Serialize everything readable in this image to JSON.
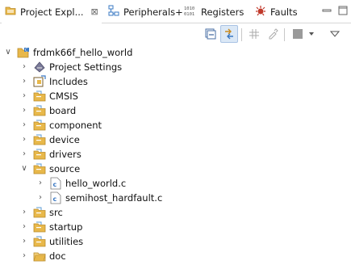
{
  "tabs": [
    {
      "label": "Project Expl...",
      "icon": "project-explorer-icon",
      "active": true
    },
    {
      "label": "Peripherals+",
      "icon": "peripherals-icon"
    },
    {
      "label": "Registers",
      "icon": "registers-icon"
    },
    {
      "label": "Faults",
      "icon": "faults-icon"
    }
  ],
  "tree": [
    {
      "label": "frdmk66f_hello_world",
      "icon": "project-folder-icon",
      "level": 0,
      "expanded": true
    },
    {
      "label": "Project Settings",
      "icon": "settings-icon",
      "level": 1
    },
    {
      "label": "Includes",
      "icon": "includes-icon",
      "level": 1
    },
    {
      "label": "CMSIS",
      "icon": "source-folder-icon",
      "level": 1
    },
    {
      "label": "board",
      "icon": "source-folder-icon",
      "level": 1
    },
    {
      "label": "component",
      "icon": "source-folder-icon",
      "level": 1
    },
    {
      "label": "device",
      "icon": "source-folder-icon",
      "level": 1
    },
    {
      "label": "drivers",
      "icon": "source-folder-icon",
      "level": 1
    },
    {
      "label": "source",
      "icon": "source-folder-icon",
      "level": 1,
      "expanded": true
    },
    {
      "label": "hello_world.c",
      "icon": "c-file-icon",
      "level": 2
    },
    {
      "label": "semihost_hardfault.c",
      "icon": "c-file-icon",
      "level": 2
    },
    {
      "label": "src",
      "icon": "source-folder-icon",
      "level": 1
    },
    {
      "label": "startup",
      "icon": "source-folder-icon",
      "level": 1
    },
    {
      "label": "utilities",
      "icon": "source-folder-icon",
      "level": 1
    },
    {
      "label": "doc",
      "icon": "folder-icon",
      "level": 1
    }
  ],
  "colors": {
    "folder": "#e8b84a",
    "accent": "#3a78c3",
    "selection": "#dbe8f6"
  }
}
